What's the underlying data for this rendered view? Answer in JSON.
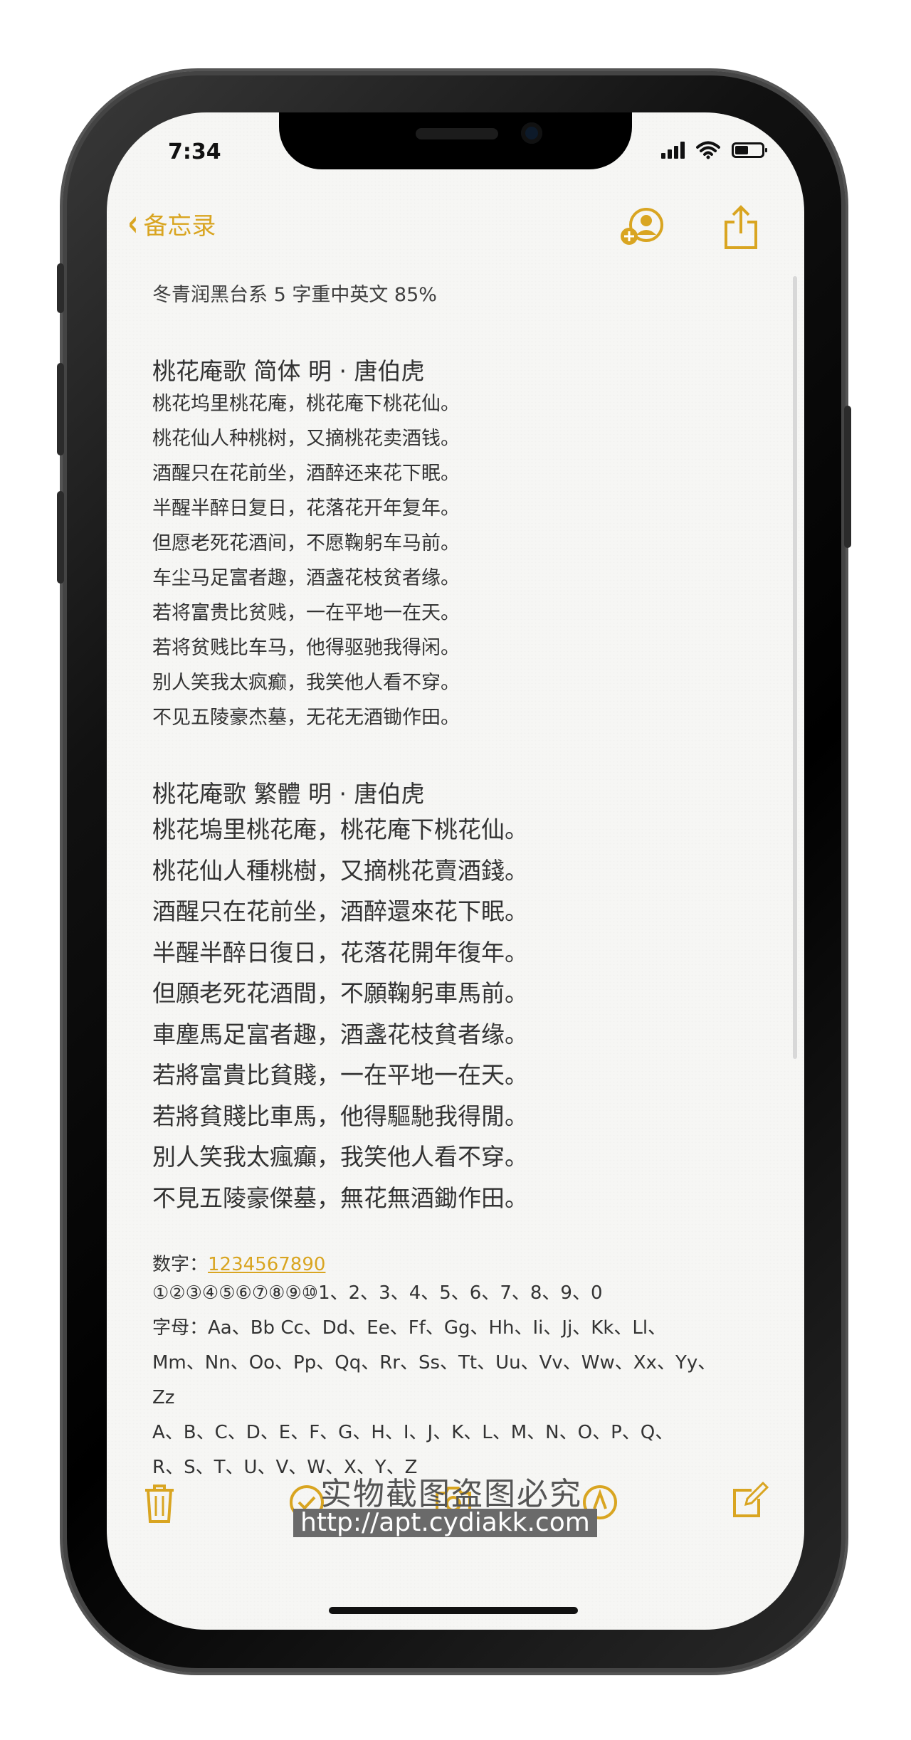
{
  "status": {
    "time": "7:34"
  },
  "nav": {
    "back_label": "备忘录"
  },
  "note": {
    "meta": "冬青润黑台系 5 字重中英文 85%",
    "simplified": {
      "title": "桃花庵歌 简体  明 · 唐伯虎",
      "lines": [
        "桃花坞里桃花庵，桃花庵下桃花仙。",
        "桃花仙人种桃树，又摘桃花卖酒钱。",
        "酒醒只在花前坐，酒醉还来花下眠。",
        "半醒半醉日复日，花落花开年复年。",
        "但愿老死花酒间，不愿鞠躬车马前。",
        "车尘马足富者趣，酒盏花枝贫者缘。",
        "若将富贵比贫贱，一在平地一在天。",
        "若将贫贱比车马，他得驱驰我得闲。",
        "别人笑我太疯癫，我笑他人看不穿。",
        "不见五陵豪杰墓，无花无酒锄作田。"
      ]
    },
    "traditional": {
      "title": "桃花庵歌 繁體     明 · 唐伯虎",
      "lines": [
        "桃花塢里桃花庵，桃花庵下桃花仙。",
        "桃花仙人種桃樹，又摘桃花賣酒錢。",
        "酒醒只在花前坐，酒醉還來花下眠。",
        "半醒半醉日復日，花落花開年復年。",
        "但願老死花酒間，不願鞠躬車馬前。",
        "車塵馬足富者趣，酒盞花枝貧者缘。",
        "若將富貴比貧賤，一在平地一在天。",
        "若將貧賤比車馬，他得驅馳我得閒。",
        "別人笑我太瘋癲，我笑他人看不穿。",
        "不見五陵豪傑墓，無花無酒鋤作田。"
      ]
    },
    "numbers_label": "数字：",
    "numbers_link": "1234567890",
    "lines_extra": [
      "①②③④⑤⑥⑦⑧⑨⑩1、2、3、4、5、6、7、8、9、0",
      "字母：Aa、Bb Cc、Dd、Ee、Ff、Gg、Hh、Ii、Jj、Kk、Ll、",
      "Mm、Nn、Oo、Pp、Qq、Rr、Ss、Tt、Uu、Vv、Ww、Xx、Yy、",
      "Zz",
      "A、B、C、D、E、F、G、H、I、J、K、L、M、N、O、P、Q、",
      "R、S、T、U、V、W、X、Y、Z"
    ]
  },
  "watermark": {
    "line1": "实物截图盗图必究",
    "line2": "http://apt.cydiakk.com"
  },
  "icons": {
    "back": "chevron-left-icon",
    "add_person": "add-person-icon",
    "share": "share-icon",
    "trash": "trash-icon",
    "compose": "compose-icon"
  },
  "colors": {
    "accent": "#d9a521"
  }
}
